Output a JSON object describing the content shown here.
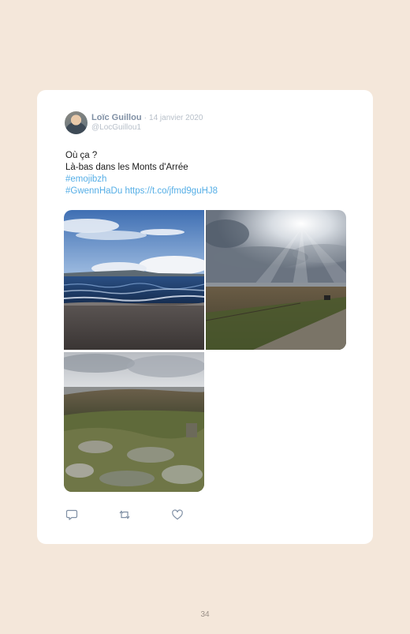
{
  "tweet": {
    "author_name": "Loïc Guillou",
    "separator": "·",
    "date": "14 janvier 2020",
    "handle": "@LocGuillou1",
    "lines": [
      "Où ça ?",
      "Là-bas dans les Monts d'Arrée"
    ],
    "hashtag_1": "#emojibzh",
    "hashtag_2": "#GwennHaDu",
    "url": "https://t.co/jfmd9guHJ8",
    "photos": [
      {
        "alt": "lake-shore-photo"
      },
      {
        "alt": "sunrays-moor-photo"
      },
      {
        "alt": "rocky-moorland-photo"
      }
    ]
  },
  "actions": {
    "reply_icon": "reply-icon",
    "retweet_icon": "retweet-icon",
    "like_icon": "heart-icon"
  },
  "page_number": "34",
  "colors": {
    "background": "#f4e7da",
    "card": "#ffffff",
    "link": "#55aee6",
    "name": "#7f8fa4",
    "meta": "#b8c0ca"
  }
}
